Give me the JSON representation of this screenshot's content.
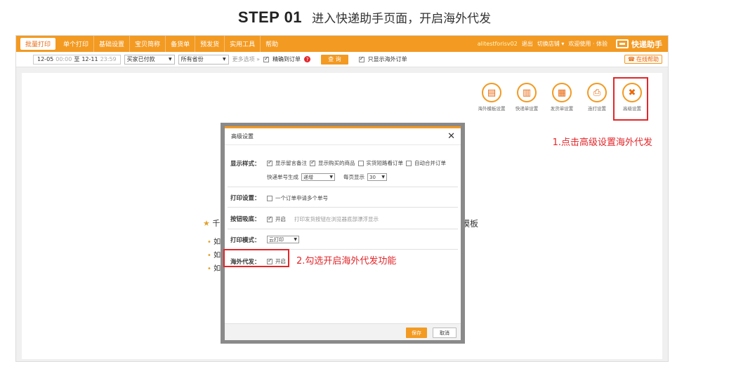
{
  "step": {
    "number": "STEP 01",
    "text": "进入快递助手页面，开启海外代发"
  },
  "nav": {
    "items": [
      "批量打印",
      "单个打印",
      "基础设置",
      "宝贝简称",
      "备货单",
      "预发货",
      "实用工具",
      "帮助"
    ],
    "user": "alitestforisv02",
    "right_links": [
      "退出",
      "切换店铺 ▾",
      "欢迎使用 · 体验"
    ],
    "brand": "快递助手"
  },
  "filter": {
    "date_from": "12-05",
    "time_from": "00:00",
    "date_sep": "至",
    "date_to": "12-11",
    "time_to": "23:59",
    "status_select": "买家已付款",
    "province_select": "所有省份",
    "more_options": "更多选项 »",
    "exact_order": "精确到订单",
    "query_button": "查 询",
    "only_overseas": "只显示海外订单",
    "online_help": "在线帮助"
  },
  "tools": [
    {
      "icon": "overseas-template-icon",
      "label": "海外模板设置"
    },
    {
      "icon": "express-form-icon",
      "label": "快递单设置"
    },
    {
      "icon": "delivery-form-icon",
      "label": "发货单设置"
    },
    {
      "icon": "printer-icon",
      "label": "连打设置"
    },
    {
      "icon": "tools-icon",
      "label": "高级设置"
    }
  ],
  "annotations": {
    "step1": "1.点击高级设置海外代发",
    "step2": "2.勾选开启海外代发功能"
  },
  "background": {
    "star_text": "千",
    "right_text": "模板",
    "bullets": [
      "如",
      "如",
      "如"
    ]
  },
  "dialog": {
    "title": "高级设置",
    "close_icon": "✕",
    "display_style": {
      "label": "显示样式：",
      "options": [
        {
          "text": "显示留言备注",
          "checked": true
        },
        {
          "text": "显示购买的商品",
          "checked": true
        },
        {
          "text": "实货短路看订单",
          "checked": false
        },
        {
          "text": "自动合并订单",
          "checked": false
        }
      ],
      "order_gen_label": "快递单号生成",
      "order_gen_value": "递增",
      "per_page_label": "每页显示",
      "per_page_value": "30"
    },
    "print_settings": {
      "label": "打印设置：",
      "option": "一个订单申请多个单号"
    },
    "button_hover": {
      "label": "按钮吸底：",
      "option": "开启",
      "hint": "打印发货按钮在浏览器底部漂浮显示"
    },
    "print_mode": {
      "label": "打印模式：",
      "value": "云打印"
    },
    "overseas": {
      "label": "海外代发：",
      "option": "开启"
    },
    "save": "保存",
    "cancel": "取消"
  },
  "colors": {
    "accent": "#f39a22",
    "highlight": "#e3262a"
  }
}
